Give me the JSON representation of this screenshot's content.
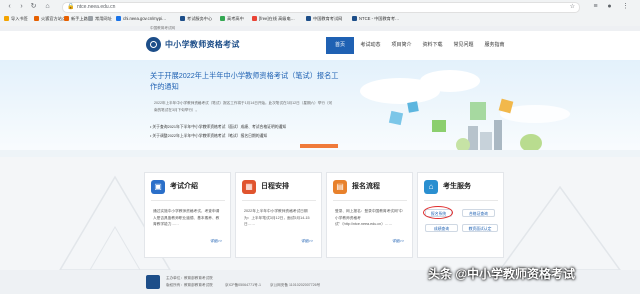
{
  "browser": {
    "url": "ntce.neea.edu.cn",
    "bookmarks": [
      "导入书签",
      "火狐官方站点",
      "新手上路",
      "常用网址",
      "chi.neea.gov.cn/mypi…",
      "考试服务中心",
      "高考高中",
      "[free]在线 高级电…",
      "中国教育考试网",
      "NTCE - 中国教育考…"
    ]
  },
  "site": {
    "topbar": "中国教育考试网",
    "title": "中小学教师资格考试",
    "nav": [
      "首页",
      "考试动态",
      "项目简介",
      "资料下载",
      "常见问题",
      "服务指南"
    ]
  },
  "hero": {
    "title": "关于开展2022年上半年中小学教师资格考试（笔试）报名工作的通知",
    "body": "2022年上半年中小学教师资格考试（笔试）报名工作将于1月14日开始。此次笔试在3月12日（星期六）举行（河南的笔试在3月下旬举行）。",
    "links": [
      "关于查询2021年下半年中小学教师资格考试（面试）成绩、考试合格证明的通知",
      "关于调整2022年上半年中小学教师资格考试（笔试）报名日期的通知"
    ]
  },
  "cards": [
    {
      "title": "考试介绍",
      "body": "通过实施中小学教师资格考试，考查申请人是否具备教师职业道德、基本素养、教育教学能力……",
      "more": "详细>>"
    },
    {
      "title": "日程安排",
      "body": "2022年上半年中小学教师资格考试日期为：上半年笔试3月12日，面试5月14-15日……",
      "more": "详细>>"
    },
    {
      "title": "报名流程",
      "body": "登录、网上报名：登录中国教育考试网\"中小学教师资格考试\"（http://ntce.neea.edu.cn）……",
      "more": "详细>>"
    },
    {
      "title": "考生服务",
      "buttons": [
        "报名系统",
        "合格证查询",
        "成绩查询",
        "教资面试认定"
      ]
    }
  ],
  "footer": {
    "org": "主办单位：教育部教育考试院",
    "rights": "版权所有：教育部教育考试院",
    "icp": "京ICP备05064771号-1",
    "police": "京公网安备 11010202007726号"
  },
  "watermark": "头条 @中小学教师资格考试",
  "colors": {
    "brand": "#1d4e89",
    "nav_active": "#1f61b3",
    "highlight": "#e02d2d"
  }
}
